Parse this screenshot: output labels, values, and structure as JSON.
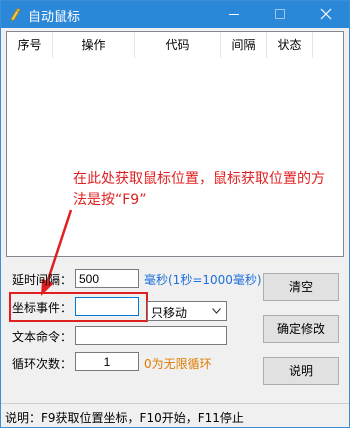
{
  "window": {
    "title": "自动鼠标"
  },
  "icons": {
    "app": "app-icon",
    "minimize": "minimize-icon",
    "maximize": "maximize-icon",
    "close": "close-icon",
    "dropdown": "chevron-down-icon"
  },
  "list": {
    "columns": [
      "序号",
      "操作",
      "代码",
      "间隔",
      "状态"
    ]
  },
  "annotation": {
    "text": "在此处获取鼠标位置，鼠标获取位置的方法是按“F9”"
  },
  "form": {
    "delay": {
      "label": "延时间隔：",
      "value": "500",
      "hint": "毫秒(1秒=1000毫秒)"
    },
    "coord": {
      "label": "坐标事件：",
      "value": "",
      "action": "只移动"
    },
    "text_cmd": {
      "label": "文本命令：",
      "value": ""
    },
    "loop": {
      "label": "循环次数：",
      "value": "1",
      "hint": "0为无限循环"
    }
  },
  "buttons": {
    "clear": "清空",
    "confirm": "确定修改",
    "help": "说明"
  },
  "status": {
    "text": "说明：F9获取位置坐标，F10开始，F11停止"
  },
  "colors": {
    "titlebar": "#2b88d8",
    "annotation": "#e02020",
    "hint_blue": "#1e6fd9",
    "hint_orange": "#e07b00",
    "focus": "#0078d7"
  }
}
